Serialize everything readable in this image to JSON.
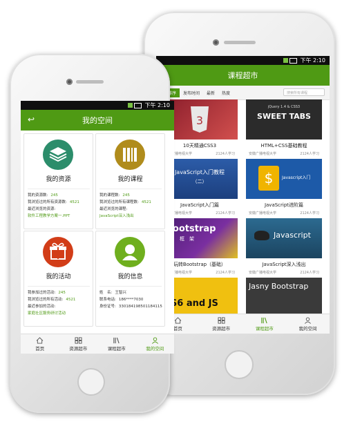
{
  "status": {
    "time": "下午 2:10"
  },
  "left": {
    "title": "我的空间",
    "cards": [
      {
        "title": "我的资源",
        "color": "#2c8d6b",
        "rows": [
          {
            "label": "我的资源数:",
            "value": "245"
          },
          {
            "label": "我浏览过的所有资源数:",
            "value": "4521"
          },
          {
            "label": "最近浏览的资源:",
            "value": ""
          },
          {
            "label": "软件工程教学方案一.PPT",
            "value": "",
            "link": true
          }
        ]
      },
      {
        "title": "我的课程",
        "color": "#b08c1c",
        "rows": [
          {
            "label": "我的课程数:",
            "value": "245"
          },
          {
            "label": "我浏览过的所有课程数:",
            "value": "4521"
          },
          {
            "label": "最近浏览的课程:",
            "value": ""
          },
          {
            "label": "JavaScript深入浅出",
            "value": "",
            "link": true
          }
        ]
      },
      {
        "title": "我的活动",
        "color": "#d23d18",
        "rows": [
          {
            "label": "我参加过的活动:",
            "value": "245"
          },
          {
            "label": "我浏览过的所有活动:",
            "value": "4521"
          },
          {
            "label": "最近参加的活动:",
            "value": ""
          },
          {
            "label": "家庭社区服务研讨活动",
            "value": "",
            "link": true
          }
        ]
      },
      {
        "title": "我的信息",
        "color": "#6faf1e",
        "rows": [
          {
            "label": "姓　名:",
            "value": "王智兴",
            "plain": true
          },
          {
            "label": "联系电话:",
            "value": "186****7030",
            "plain": true
          },
          {
            "label": "身份证号:",
            "value": "330184198501184115",
            "plain": true
          }
        ]
      }
    ],
    "tabs": [
      "首页",
      "资源超市",
      "课程超市",
      "我的空间"
    ]
  },
  "right": {
    "title": "课程超市",
    "filters": [
      "综合排序",
      "发布时间",
      "最新",
      "热度"
    ],
    "search_placeholder": "搜索所有课程",
    "courses": [
      {
        "name": "10天精通CSS3",
        "school": "安徽广播电视大学",
        "count": "2124人学习",
        "thumb_text": "",
        "bg": "#b1323a"
      },
      {
        "name": "HTML+CSS基础教程",
        "school": "安徽广播电视大学",
        "count": "2124人学习",
        "thumb_text": "SWEET TABS",
        "thumb_sub": "jQuery 1.4 & CSS3",
        "bg": "#2f2f2f"
      },
      {
        "name": "JavaScript入门篇",
        "school": "安徽广播电视大学",
        "count": "2124人学习",
        "thumb_text": "JavaScript入门教程",
        "thumb_sub": "（二）",
        "bg": "#2f5aa8"
      },
      {
        "name": "JavaScript进阶篇",
        "school": "安徽广播电视大学",
        "count": "2124人学习",
        "thumb_text": "Javascript入门",
        "bg": "#1d5aa8"
      },
      {
        "name": "玩转Bootstrap（基础）",
        "school": "安徽广播电视大学",
        "count": "2124人学习",
        "thumb_text": "Bootstrap",
        "thumb_sub": "框　架",
        "bg": "#5b2580"
      },
      {
        "name": "JavaScript深入浅出",
        "school": "安徽广播电视大学",
        "count": "2124人学习",
        "thumb_text": "Javascript",
        "bg": "#24587d"
      },
      {
        "name": "",
        "school": "",
        "count": "",
        "thumb_text": "ES6 and JS",
        "bg": "#f0c010"
      },
      {
        "name": "",
        "school": "",
        "count": "",
        "thumb_text": "Jasny Bootstrap",
        "bg": "#3a3a3a"
      }
    ],
    "tabs": [
      "首页",
      "资源超市",
      "课程超市",
      "我的空间"
    ]
  }
}
